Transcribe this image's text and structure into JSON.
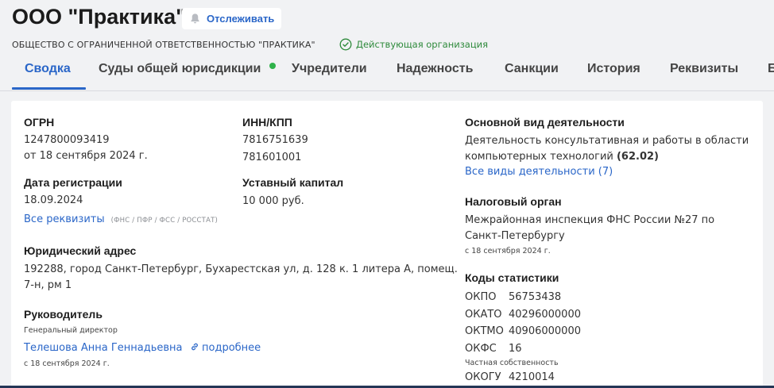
{
  "header": {
    "title": "ООО \"Практика\"",
    "track_label": "Отслеживать",
    "full_name": "ОБЩЕСТВО С ОГРАНИЧЕННОЙ ОТВЕТСТВЕННОСТЬЮ \"ПРАКТИКА\"",
    "status": "Действующая организация"
  },
  "tabs": [
    {
      "label": "Сводка"
    },
    {
      "label": "Суды общей юрисдикции"
    },
    {
      "label": "Учредители"
    },
    {
      "label": "Надежность"
    },
    {
      "label": "Санкции"
    },
    {
      "label": "История"
    },
    {
      "label": "Реквизиты"
    },
    {
      "label": "Б"
    }
  ],
  "summary": {
    "ogrn_label": "ОГРН",
    "ogrn_value": "1247800093419",
    "ogrn_date": "от 18 сентября 2024 г.",
    "inn_label": "ИНН/КПП",
    "inn_value": "7816751639",
    "kpp_value": "781601001",
    "reg_label": "Дата регистрации",
    "reg_value": "18.09.2024",
    "capital_label": "Уставный капитал",
    "capital_value": "10 000 руб.",
    "all_requisites": "Все реквизиты",
    "requisites_sources": "(ФНС / ПФР / ФСС / РОССТАТ)",
    "address_label": "Юридический адрес",
    "address_line1": "192288, город Санкт-Петербург, Бухарестская ул, д. 128 к. 1 литера А, помещ.",
    "address_line2": "7-н, рм 1",
    "head_label": "Руководитель",
    "head_position": "Генеральный директор",
    "head_name": "Телешова Анна Геннадьевна",
    "head_more": "подробнее",
    "head_since": "с 18 сентября 2024 г.",
    "activity_label": "Основной вид деятельности",
    "activity_line1": "Деятельность консультативная и работы в области",
    "activity_line2": "компьютерных технологий",
    "activity_code": "(62.02)",
    "activity_all": "Все виды деятельности (7)",
    "tax_label": "Налоговый орган",
    "tax_line1": "Межрайонная инспекция ФНС России №27 по",
    "tax_line2": "Санкт-Петербургу",
    "tax_since": "с 18 сентября 2024 г.",
    "codes_label": "Коды статистики",
    "codes": [
      {
        "k": "ОКПО",
        "v": "56753438"
      },
      {
        "k": "ОКАТО",
        "v": "40296000000"
      },
      {
        "k": "ОКТМО",
        "v": "40906000000"
      },
      {
        "k": "ОКФС",
        "v": "16"
      }
    ],
    "okfs_note": "Частная собственность",
    "okogu": {
      "k": "ОКОГУ",
      "v": "4210014"
    }
  },
  "colors": {
    "accent": "#2a66c8",
    "status_green": "#2e8a3b",
    "dot_green": "#2fb24a"
  },
  "icons": [
    "bell-icon",
    "check-circle-icon",
    "link-icon"
  ]
}
